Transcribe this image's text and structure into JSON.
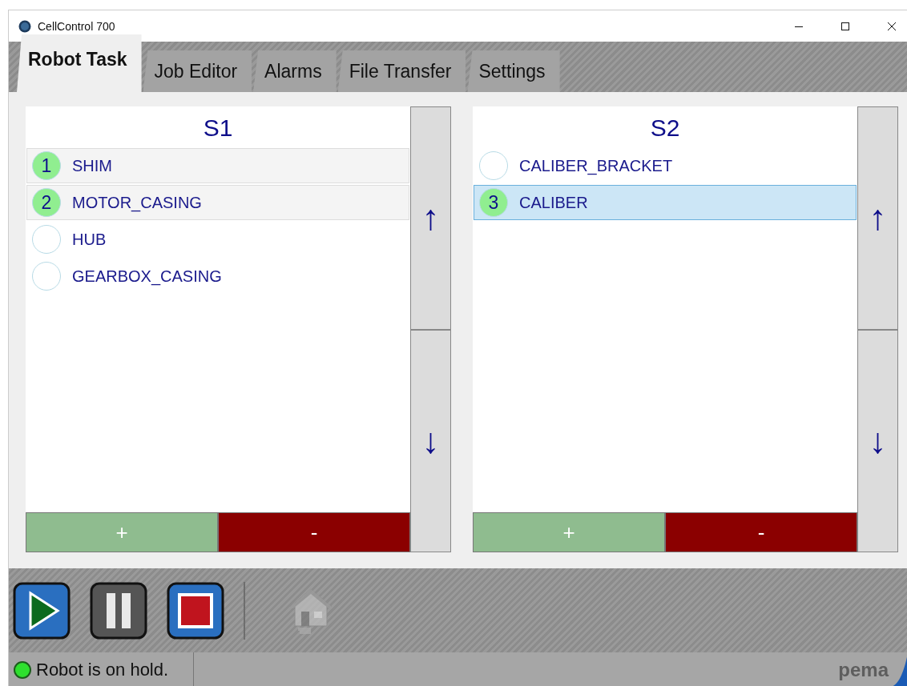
{
  "window": {
    "title": "CellControl 700"
  },
  "tabs": [
    {
      "label": "Robot Task",
      "selected": true
    },
    {
      "label": "Job Editor",
      "selected": false
    },
    {
      "label": "Alarms",
      "selected": false
    },
    {
      "label": "File Transfer",
      "selected": false
    },
    {
      "label": "Settings",
      "selected": false
    }
  ],
  "stations": [
    {
      "title": "S1",
      "up": "↑",
      "down": "↓",
      "add": "+",
      "remove": "-",
      "items": [
        {
          "order": "1",
          "name": "SHIM",
          "queued": true,
          "selected": false
        },
        {
          "name": "MOTOR_CASING",
          "order": "2",
          "queued": true,
          "selected": false
        },
        {
          "name": "HUB",
          "queued": false,
          "selected": false
        },
        {
          "name": "GEARBOX_CASING",
          "queued": false,
          "selected": false
        }
      ]
    },
    {
      "title": "S2",
      "up": "↑",
      "down": "↓",
      "add": "+",
      "remove": "-",
      "items": [
        {
          "name": "CALIBER_BRACKET",
          "queued": false,
          "selected": false
        },
        {
          "name": "CALIBER",
          "order": "3",
          "queued": true,
          "selected": true
        }
      ]
    }
  ],
  "toolbar": {
    "home_disabled": true
  },
  "status_bar": {
    "led_on": true,
    "text": "Robot is on hold.",
    "logo": "pema"
  }
}
